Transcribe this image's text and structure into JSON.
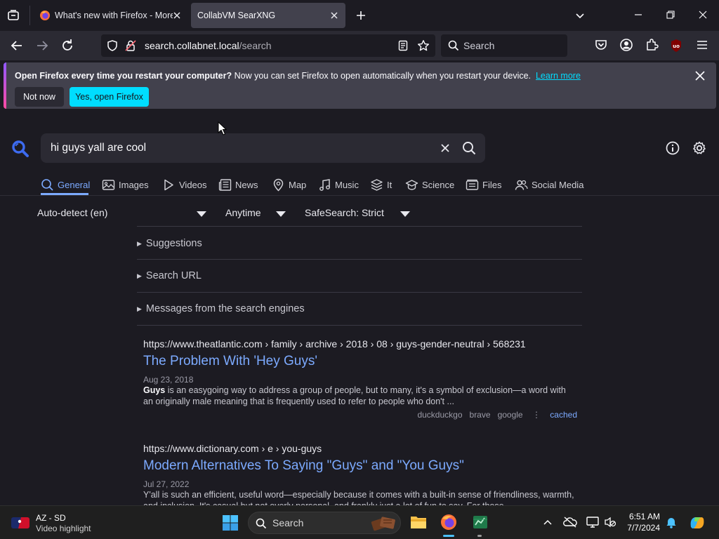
{
  "tabs": [
    {
      "title": "What's new with Firefox - More",
      "active": false
    },
    {
      "title": "CollabVM SearXNG",
      "active": true
    }
  ],
  "nav": {
    "url_domain": "search.collabnet.local",
    "url_path": "/search",
    "search_placeholder": "Search"
  },
  "notification": {
    "bold_text": "Open Firefox every time you restart your computer?",
    "text": " Now you can set Firefox to open automatically when you restart your device.",
    "link": "Learn more",
    "secondary_button": "Not now",
    "primary_button": "Yes, open Firefox"
  },
  "search": {
    "query": "hi guys yall are cool"
  },
  "categories": [
    {
      "label": "General",
      "icon": "search-icon",
      "active": true
    },
    {
      "label": "Images",
      "icon": "image-icon",
      "active": false
    },
    {
      "label": "Videos",
      "icon": "play-icon",
      "active": false
    },
    {
      "label": "News",
      "icon": "newspaper-icon",
      "active": false
    },
    {
      "label": "Map",
      "icon": "map-pin-icon",
      "active": false
    },
    {
      "label": "Music",
      "icon": "music-icon",
      "active": false
    },
    {
      "label": "It",
      "icon": "layers-icon",
      "active": false
    },
    {
      "label": "Science",
      "icon": "science-icon",
      "active": false
    },
    {
      "label": "Files",
      "icon": "files-icon",
      "active": false
    },
    {
      "label": "Social Media",
      "icon": "people-icon",
      "active": false
    }
  ],
  "filters": {
    "language": "Auto-detect (en)",
    "time": "Anytime",
    "safesearch": "SafeSearch: Strict"
  },
  "sections": {
    "suggestions": "Suggestions",
    "search_url": "Search URL",
    "messages": "Messages from the search engines"
  },
  "results": [
    {
      "url": "https://www.theatlantic.com",
      "path": " › family › archive › 2018 › 08 › guys-gender-neutral › 568231",
      "title": "The Problem With 'Hey Guys'",
      "date": "Aug 23, 2018",
      "snippet_bold": "Guys",
      "snippet": " is an easygoing way to address a group of people, but to many, it's a symbol of exclusion—a word with an originally male meaning that is frequently used to refer to people who don't ...",
      "engines": [
        "duckduckgo",
        "brave",
        "google"
      ],
      "cached": "cached"
    },
    {
      "url": "https://www.dictionary.com",
      "path": " › e › you-guys",
      "title": "Modern Alternatives To Saying \"Guys\" and \"You Guys\"",
      "date": "Jul 27, 2022",
      "snippet": "Y'all is such an efficient, useful word—especially because it comes with a built-in sense of friendliness, warmth, and inclusion. It's casual but not overly personal, and frankly just a lot of fun to say. For those"
    }
  ],
  "taskbar": {
    "widget_title": "AZ - SD",
    "widget_subtitle": "Video highlight",
    "search_placeholder": "Search",
    "time": "6:51 AM",
    "date": "7/7/2024"
  },
  "colors": {
    "primary_button": "#00ddff",
    "link": "#7caaff",
    "searx_icon": "#3d6bf0"
  }
}
